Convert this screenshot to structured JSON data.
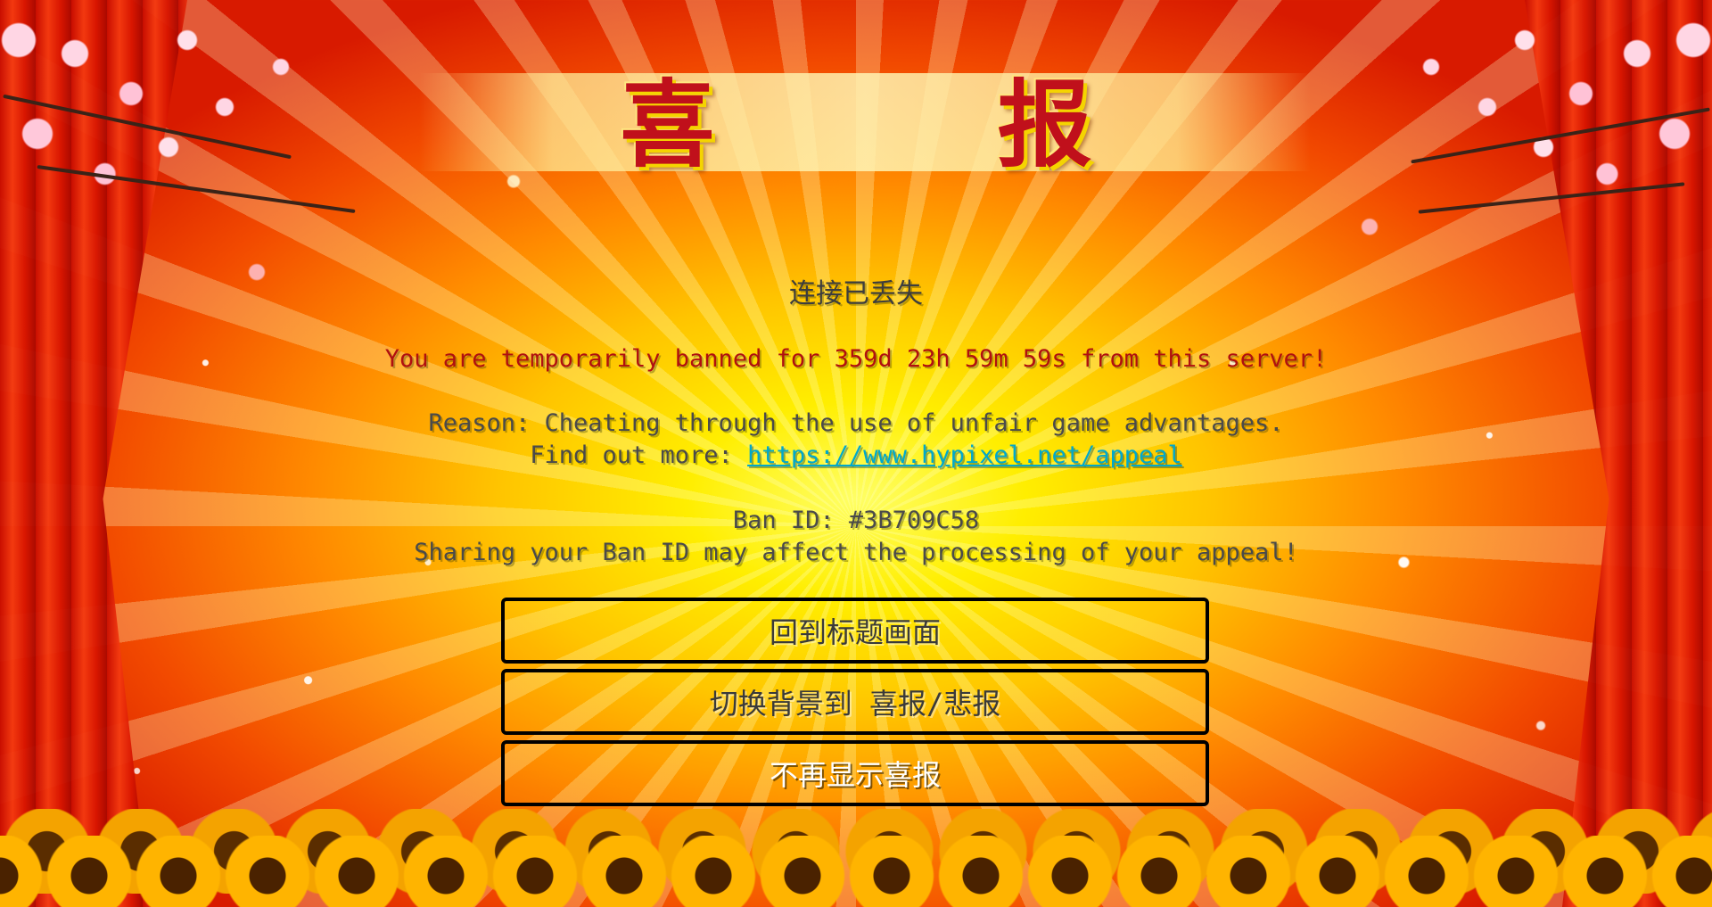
{
  "screen": {
    "title": "喜   报",
    "heading": "连接已丢失",
    "ban_message": "You are temporarily banned for 359d 23h 59m 59s from this server!",
    "reason": "Reason: Cheating through the use of unfair game advantages.",
    "find_more_prefix": "Find out more: ",
    "appeal_link": "https://www.hypixel.net/appeal",
    "ban_id": "Ban ID: #3B709C58",
    "sharing_warning": "Sharing your Ban ID may affect the processing of your appeal!"
  },
  "buttons": {
    "back_to_title": "回到标题画面",
    "switch_background": "切换背景到 喜报/悲报",
    "dont_show_again": "不再显示喜报"
  },
  "colors": {
    "ban_text": "#b01010",
    "link": "#00a8cc",
    "title": "#c0101b"
  }
}
